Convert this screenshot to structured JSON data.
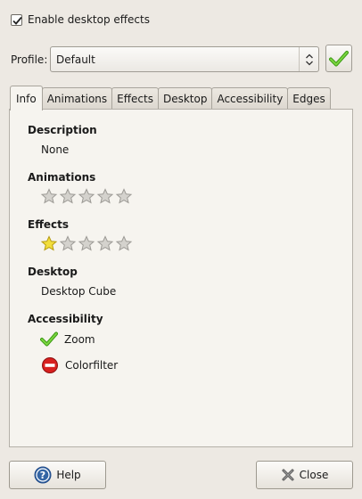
{
  "enable_effects": {
    "label": "Enable desktop effects",
    "checked": true
  },
  "profile": {
    "label": "Profile:",
    "value": "Default"
  },
  "tabs": [
    {
      "label": "Info",
      "active": true
    },
    {
      "label": "Animations"
    },
    {
      "label": "Effects"
    },
    {
      "label": "Desktop"
    },
    {
      "label": "Accessibility"
    },
    {
      "label": "Edges"
    }
  ],
  "info": {
    "description": {
      "title": "Description",
      "value": "None"
    },
    "animations": {
      "title": "Animations",
      "rating": 0,
      "max": 5
    },
    "effects": {
      "title": "Effects",
      "rating": 1,
      "max": 5
    },
    "desktop": {
      "title": "Desktop",
      "value": "Desktop Cube"
    },
    "accessibility": {
      "title": "Accessibility",
      "items": [
        {
          "label": "Zoom",
          "icon": "check-icon"
        },
        {
          "label": "Colorfilter",
          "icon": "no-entry-icon"
        }
      ]
    }
  },
  "buttons": {
    "help": "Help",
    "close": "Close"
  },
  "colors": {
    "check_green": "#4caa1e",
    "star_yellow": "#f2de3c",
    "star_grey": "#d4d2cd",
    "no_entry_red": "#d8201f"
  }
}
